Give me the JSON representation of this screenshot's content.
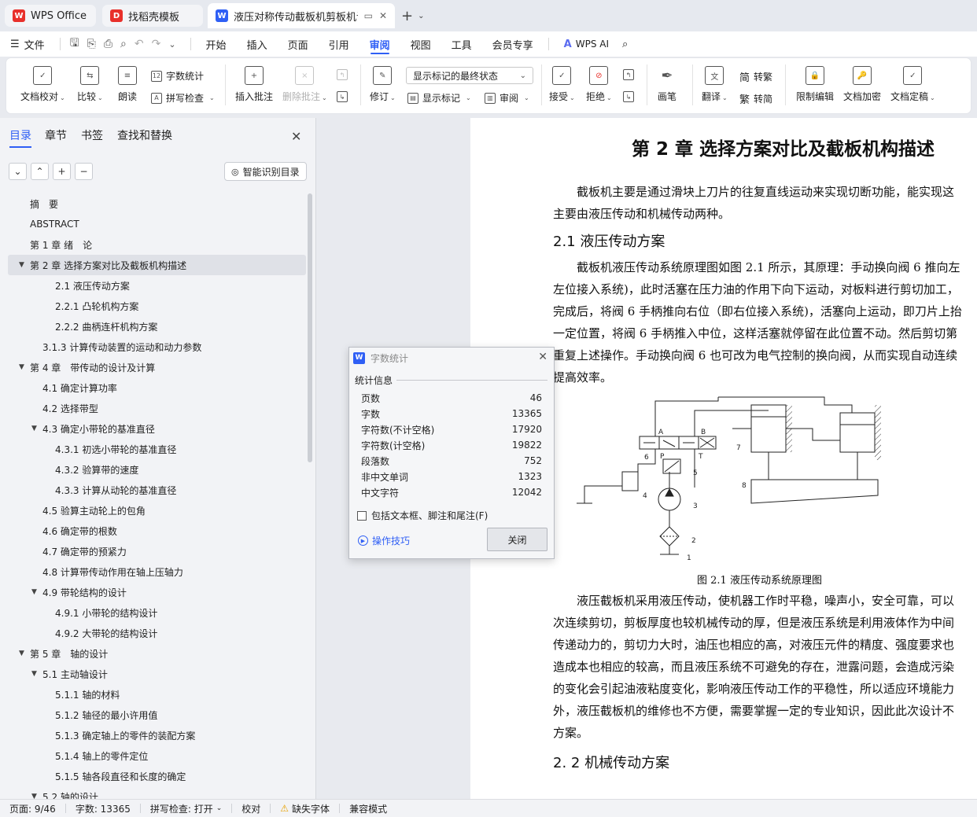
{
  "tabs": [
    {
      "label": "WPS Office",
      "icon": "wps-logo-icon",
      "color": "#e8302b"
    },
    {
      "label": "找稻壳模板",
      "icon": "docer-icon",
      "color": "#e8302b"
    },
    {
      "label": "液压对称传动截板机剪板机设计",
      "icon": "word-doc-icon",
      "color": "#2f5ff5"
    }
  ],
  "menu": {
    "file": "文件",
    "items": [
      "开始",
      "插入",
      "页面",
      "引用",
      "审阅",
      "视图",
      "工具",
      "会员专享"
    ],
    "active": "审阅",
    "wps_ai": "WPS AI"
  },
  "ribbon": {
    "doc_proof": "文档校对",
    "compare": "比较",
    "read_aloud": "朗读",
    "word_count": "字数统计",
    "spell_check": "拼写检查",
    "insert_comment": "插入批注",
    "delete_comment": "删除批注",
    "revise": "修订",
    "markup_state": "显示标记的最终状态",
    "show_markup": "显示标记",
    "review": "审阅",
    "accept": "接受",
    "reject": "拒绝",
    "draw_pen": "画笔",
    "translate": "翻译",
    "to_traditional": "转繁",
    "to_simplified": "转简",
    "restrict_edit": "限制编辑",
    "encrypt": "文档加密",
    "finalize": "文档定稿"
  },
  "nav": {
    "tabs": [
      "目录",
      "章节",
      "书签",
      "查找和替换"
    ],
    "active_tab": "目录",
    "smart_toc": "智能识别目录",
    "toc": [
      {
        "text": "摘　要",
        "level": 1,
        "caret": false
      },
      {
        "text": "ABSTRACT",
        "level": 1,
        "caret": false
      },
      {
        "text": "第 1 章  绪　论",
        "level": 1,
        "caret": false
      },
      {
        "text": "第 2 章  选择方案对比及截板机构描述",
        "level": 1,
        "caret": true,
        "selected": true
      },
      {
        "text": "2.1 液压传动方案",
        "level": 3,
        "caret": false
      },
      {
        "text": "2.2.1 凸轮机构方案",
        "level": 3,
        "caret": false
      },
      {
        "text": "2.2.2 曲柄连杆机构方案",
        "level": 3,
        "caret": false
      },
      {
        "text": "3.1.3 计算传动装置的运动和动力参数",
        "level": 2,
        "caret": false
      },
      {
        "text": "第 4 章　带传动的设计及计算",
        "level": 1,
        "caret": true
      },
      {
        "text": "4.1  确定计算功率",
        "level": 2,
        "caret": false
      },
      {
        "text": "4.2  选择带型",
        "level": 2,
        "caret": false
      },
      {
        "text": "4.3  确定小带轮的基准直径",
        "level": 2,
        "caret": true
      },
      {
        "text": "4.3.1 初选小带轮的基准直径",
        "level": 3,
        "caret": false
      },
      {
        "text": "4.3.2 验算带的速度",
        "level": 3,
        "caret": false
      },
      {
        "text": "4.3.3 计算从动轮的基准直径",
        "level": 3,
        "caret": false
      },
      {
        "text": "4.5 验算主动轮上的包角",
        "level": 2,
        "caret": false
      },
      {
        "text": "4.6 确定带的根数",
        "level": 2,
        "caret": false
      },
      {
        "text": "4.7  确定带的预紧力",
        "level": 2,
        "caret": false
      },
      {
        "text": "4.8 计算带传动作用在轴上压轴力",
        "level": 2,
        "caret": false
      },
      {
        "text": "4.9  带轮结构的设计",
        "level": 2,
        "caret": true
      },
      {
        "text": "4.9.1 小带轮的结构设计",
        "level": 3,
        "caret": false
      },
      {
        "text": "4.9.2 大带轮的结构设计",
        "level": 3,
        "caret": false
      },
      {
        "text": "第 5 章　轴的设计",
        "level": 1,
        "caret": true
      },
      {
        "text": "5.1 主动轴设计",
        "level": 2,
        "caret": true
      },
      {
        "text": "5.1.1 轴的材料",
        "level": 3,
        "caret": false
      },
      {
        "text": "5.1.2  轴径的最小许用值",
        "level": 3,
        "caret": false
      },
      {
        "text": "5.1.3 确定轴上的零件的装配方案",
        "level": 3,
        "caret": false
      },
      {
        "text": "5.1.4  轴上的零件定位",
        "level": 3,
        "caret": false
      },
      {
        "text": "5.1.5 轴各段直径和长度的确定",
        "level": 3,
        "caret": false
      },
      {
        "text": "5.2 轴的设计",
        "level": 2,
        "caret": true
      }
    ]
  },
  "document": {
    "chapter_title": "第 2 章  选择方案对比及截板机构描述",
    "heading_marker": "H",
    "intro": [
      "截板机主要是通过滑块上刀片的往复直线运动来实现切断功能，能实现这",
      "主要由液压传动和机械传动两种。"
    ],
    "h2_1": "2.1 液压传动方案",
    "para1": [
      "截板机液压传动系统原理图如图 2.1 所示，其原理：手动换向阀 6 推向左",
      "左位接入系统)，此时活塞在压力油的作用下向下运动，对板料进行剪切加工，",
      "完成后，将阀 6 手柄推向右位（即右位接入系统)，活塞向上运动，即刀片上抬",
      "一定位置，将阀 6 手柄推入中位，这样活塞就停留在此位置不动。然后剪切第",
      "重复上述操作。手动换向阀 6 也可改为电气控制的换向阀，从而实现自动连续",
      "提高效率。"
    ],
    "figure_labels": [
      "A",
      "B",
      "P",
      "T",
      "6",
      "7",
      "5",
      "4",
      "3",
      "2",
      "1",
      "8"
    ],
    "figure_caption": "图 2.1  液压传动系统原理图",
    "para2": [
      "液压截板机采用液压传动，使机器工作时平稳，噪声小，安全可靠，可以",
      "次连续剪切，剪板厚度也较机械传动的厚，但是液压系统是利用液体作为中间",
      "传递动力的，剪切力大时，油压也相应的高，对液压元件的精度、强度要求也",
      "造成本也相应的较高，而且液压系统不可避免的存在，泄露问题，会造成污染",
      "的变化会引起油液粘度变化，影响液压传动工作的平稳性，所以适应环境能力",
      "外，液压截板机的维修也不方便，需要掌握一定的专业知识，因此此次设计不",
      "方案。"
    ],
    "h2_2": "2. 2 机械传动方案"
  },
  "dialog": {
    "title": "字数统计",
    "section": "统计信息",
    "stats": [
      {
        "label": "页数",
        "value": "46"
      },
      {
        "label": "字数",
        "value": "13365"
      },
      {
        "label": "字符数(不计空格)",
        "value": "17920"
      },
      {
        "label": "字符数(计空格)",
        "value": "19822"
      },
      {
        "label": "段落数",
        "value": "752"
      },
      {
        "label": "非中文单词",
        "value": "1323"
      },
      {
        "label": "中文字符",
        "value": "12042"
      }
    ],
    "checkbox_label": "包括文本框、脚注和尾注(F)",
    "tips": "操作技巧",
    "close": "关闭"
  },
  "status": {
    "page": "页面: 9/46",
    "words": "字数: 13365",
    "spell": "拼写检查: 打开",
    "proof": "校对",
    "missing_font": "缺失字体",
    "compat": "兼容模式"
  },
  "colors": {
    "accent": "#2f5ff5",
    "wps_red": "#e8302b"
  }
}
